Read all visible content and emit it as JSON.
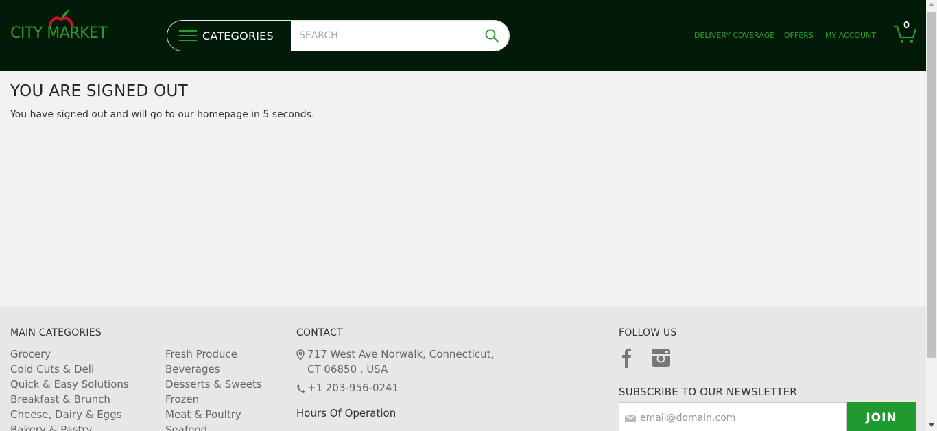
{
  "header": {
    "logo_text": "CITY MARKET",
    "categories_label": "CATEGORIES",
    "search_placeholder": "SEARCH",
    "nav": {
      "delivery": "DELIVERY COVERAGE",
      "offers": "OFFERS",
      "account": "MY ACCOUNT"
    },
    "cart_count": "0"
  },
  "main": {
    "title": "YOU ARE SIGNED OUT",
    "message": "You have signed out and will go to our homepage in 5 seconds."
  },
  "footer": {
    "main_categories_heading": "MAIN CATEGORIES",
    "categories_col1": [
      "Grocery",
      "Cold Cuts & Deli",
      "Quick & Easy Solutions",
      "Breakfast & Brunch",
      "Cheese, Dairy & Eggs",
      "Bakery & Pastry"
    ],
    "categories_col2": [
      "Fresh Produce",
      "Beverages",
      "Desserts & Sweets",
      "Frozen",
      "Meat & Poultry",
      "Seafood"
    ],
    "contact_heading": "CONTACT",
    "address_line1": "717 West Ave Norwalk, Connecticut,",
    "address_line2": "CT 06850 , USA",
    "phone": "+1 203-956-0241",
    "hours_label": "Hours Of Operation",
    "follow_heading": "FOLLOW US",
    "newsletter_heading": "SUBSCRIBE TO OUR NEWSLETTER",
    "newsletter_placeholder": "email@domain.com",
    "join_label": "JOIN"
  },
  "colors": {
    "header_bg": "#021a08",
    "accent_green": "#2c9d2c",
    "join_green": "#1f9a2f",
    "apple_red": "#c8102e"
  },
  "icons": [
    "hamburger-icon",
    "search-icon",
    "cart-icon",
    "map-pin-icon",
    "phone-icon",
    "facebook-icon",
    "instagram-icon",
    "mail-icon",
    "apple-icon"
  ]
}
